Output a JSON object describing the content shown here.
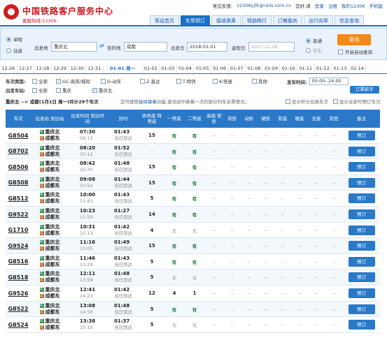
{
  "header": {
    "brand": "中国铁路客户服务中心",
    "hotline": "客服热线:12306",
    "feedback_label": "意见反馈:",
    "feedback_email": "12306yjfk@rails.com.cn",
    "greeting": "您好,请",
    "login": "登录",
    "register": "注册",
    "my12306": "我的12306",
    "mobile": "手机版"
  },
  "nav": [
    "客运首页",
    "车票预订",
    "接续换乘",
    "铁路畅行",
    "订餐服务",
    "出行向导",
    "信息查询"
  ],
  "query": {
    "oneway": "单程",
    "roundtrip": "往返",
    "from_label": "出发地",
    "from_value": "重庆北",
    "to_label": "目的地",
    "to_value": "成都",
    "depart_label": "出发日",
    "depart_value": "2018-01-01",
    "return_label": "返程日",
    "return_value": "2017-12-26",
    "normal": "普通",
    "student": "学生",
    "query_button": "查询",
    "auto_query": "开启自动查询"
  },
  "dates": [
    "12-26",
    "12-27",
    "12-28",
    "12-29",
    "12-30",
    "12-31",
    "01-01 周一",
    "01-02",
    "01-03",
    "01-04",
    "01-05",
    "01-06",
    "01-07",
    "01-08",
    "01-09",
    "01-10",
    "01-11",
    "01-12",
    "01-13",
    "01-14"
  ],
  "filters": {
    "type_label": "车次类型:",
    "types": [
      {
        "label": "全部",
        "checked": false
      },
      {
        "label": "GC-高铁/城际",
        "checked": true
      },
      {
        "label": "D-动车",
        "checked": false
      },
      {
        "label": "Z-直达",
        "checked": false
      },
      {
        "label": "T-特快",
        "checked": false
      },
      {
        "label": "K-快速",
        "checked": false
      },
      {
        "label": "其他",
        "checked": false
      }
    ],
    "depart_time_label": "发车时间:",
    "depart_time_value": "00:00--24:00",
    "station_label": "出发车站:",
    "stations": [
      {
        "label": "全部",
        "checked": false
      },
      {
        "label": "重庆",
        "checked": false
      },
      {
        "label": "重庆北",
        "checked": true
      }
    ],
    "booking_btn": "订票新手"
  },
  "summary": {
    "route": "重庆北 --> 成都(1月1日 周一)共计29个车次",
    "notice_pre": "您可使用",
    "notice_link": "接续换乘",
    "notice_post": "功能,查询途中换乘一次的部分列车余票情况。",
    "opt1": "显示积分兑换车次",
    "opt2": "显示全部可预订车次"
  },
  "table": {
    "headers": [
      "车次",
      "出发站 到达站",
      "出发时间 到达时间",
      "历时",
      "商务座 特等座",
      "一等座",
      "二等座",
      "高级 软卧",
      "软卧",
      "动卧",
      "硬卧",
      "软座",
      "硬座",
      "无座",
      "其他",
      "备注"
    ],
    "rows": [
      {
        "train": "G8504",
        "from": "重庆北",
        "to": "成都东",
        "dep": "07:30",
        "arr": "09:13",
        "dur": "01:43",
        "day": "当日到达",
        "biz": "15",
        "first": "有",
        "second": "有",
        "book": "预订"
      },
      {
        "train": "G8702",
        "from": "重庆北",
        "to": "成都东",
        "dep": "08:20",
        "arr": "10:12",
        "dur": "01:52",
        "day": "当日到达",
        "biz": "--",
        "first": "有",
        "second": "有",
        "book": "预订"
      },
      {
        "train": "G8506",
        "from": "重庆北",
        "to": "成都东",
        "dep": "08:42",
        "arr": "10:30",
        "dur": "01:48",
        "day": "当日到达",
        "biz": "15",
        "first": "有",
        "second": "有",
        "book": "预订"
      },
      {
        "train": "G8508",
        "from": "重庆北",
        "to": "成都东",
        "dep": "09:08",
        "arr": "10:52",
        "dur": "01:44",
        "day": "当日到达",
        "biz": "15",
        "first": "有",
        "second": "有",
        "book": "预订"
      },
      {
        "train": "G8512",
        "from": "重庆北",
        "to": "成都东",
        "dep": "10:00",
        "arr": "11:43",
        "dur": "01:43",
        "day": "当日到达",
        "biz": "5",
        "first": "有",
        "second": "有",
        "book": "预订"
      },
      {
        "train": "G9522",
        "from": "重庆北",
        "to": "成都东",
        "dep": "10:23",
        "arr": "11:50",
        "dur": "01:27",
        "day": "当日到达",
        "biz": "14",
        "first": "有",
        "second": "有",
        "book": "预订"
      },
      {
        "train": "G1710",
        "from": "重庆北",
        "to": "成都东",
        "dep": "10:31",
        "arr": "12:13",
        "dur": "01:42",
        "day": "当日到达",
        "biz": "4",
        "first": "无",
        "second": "无",
        "book": "预订"
      },
      {
        "train": "G9524",
        "from": "重庆北",
        "to": "成都东",
        "dep": "11:16",
        "arr": "13:05",
        "dur": "01:49",
        "day": "当日到达",
        "biz": "15",
        "first": "有",
        "second": "有",
        "book": "预订"
      },
      {
        "train": "G8516",
        "from": "重庆北",
        "to": "成都东",
        "dep": "11:46",
        "arr": "13:29",
        "dur": "01:43",
        "day": "当日到达",
        "biz": "5",
        "first": "有",
        "second": "有",
        "book": "预订"
      },
      {
        "train": "G8518",
        "from": "重庆北",
        "to": "成都东",
        "dep": "12:11",
        "arr": "13:59",
        "dur": "01:48",
        "day": "当日到达",
        "biz": "5",
        "first": "无",
        "second": "无",
        "book": "预订"
      },
      {
        "train": "G9526",
        "from": "重庆北",
        "to": "成都东",
        "dep": "12:41",
        "arr": "14:23",
        "dur": "01:42",
        "day": "当日到达",
        "biz": "12",
        "first": "4",
        "second": "1",
        "book": "预订"
      },
      {
        "train": "G8522",
        "from": "重庆北",
        "to": "成都东",
        "dep": "13:08",
        "arr": "14:56",
        "dur": "01:48",
        "day": "当日到达",
        "biz": "5",
        "first": "有",
        "second": "有",
        "book": "预订"
      },
      {
        "train": "G8524",
        "from": "重庆北",
        "to": "成都东",
        "dep": "13:38",
        "arr": "15:15",
        "dur": "01:37",
        "day": "当日到达",
        "biz": "5",
        "first": "无",
        "second": "无",
        "book": "预订"
      }
    ]
  },
  "colors": {
    "primary": "#2a79c9",
    "accent": "#f08a1c",
    "brand_red": "#c8161d"
  }
}
